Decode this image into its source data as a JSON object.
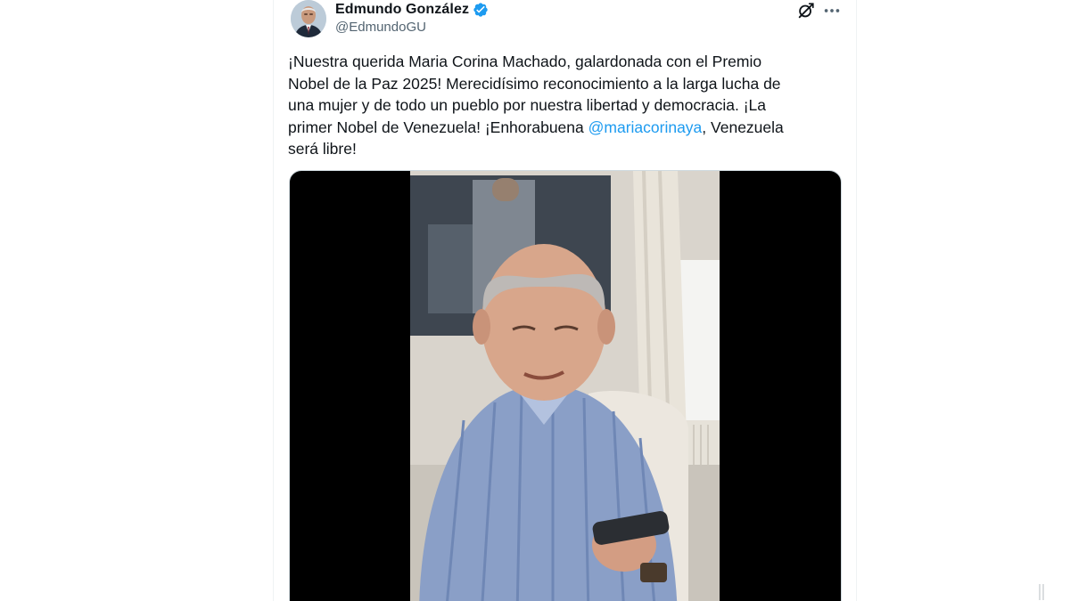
{
  "tweet": {
    "author": {
      "display_name": "Edmundo González",
      "handle": "@EdmundoGU",
      "verified": true,
      "avatar_icon": "profile-photo"
    },
    "text_lines": [
      {
        "text": "¡Nuestra querida Maria Corina Machado, galardonada con el Premio"
      },
      {
        "text": "Nobel de la Paz 2025! Merecidísimo reconocimiento a la larga lucha de"
      },
      {
        "text": "una mujer y de todo un pueblo por nuestra libertad y democracia. ¡La"
      },
      {
        "before": "primer Nobel de Venezuela! ¡Enhorabuena ",
        "mention": "@mariacorinaya",
        "after": ", Venezuela"
      },
      {
        "text": "será libre!"
      }
    ],
    "actions": {
      "grok_icon": "grok-icon",
      "more_icon": "more-options-icon"
    },
    "media": {
      "type": "video",
      "thumbnail_icon": "video-frame"
    }
  },
  "colors": {
    "text": "#0f1419",
    "secondary": "#536471",
    "mention": "#1d9bf0",
    "verified": "#1d9bf0",
    "background": "#ffffff"
  }
}
